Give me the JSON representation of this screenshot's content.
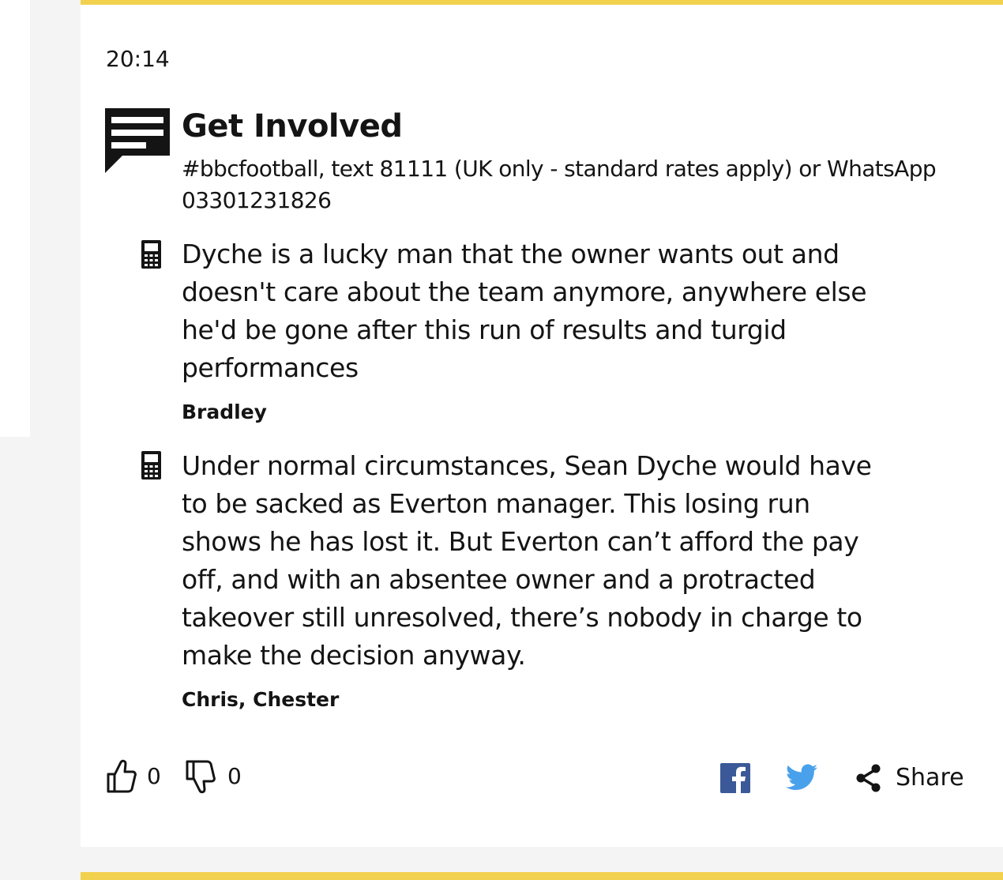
{
  "colors": {
    "accent_rule": "#f2d14f",
    "facebook": "#3b5998",
    "twitter": "#4aa1eb",
    "text": "#141414"
  },
  "post": {
    "time": "20:14",
    "get_involved": {
      "icon": "speech-bubble-icon",
      "title": "Get Involved",
      "subtitle": "#bbcfootball, text 81111 (UK only - standard rates apply) or WhatsApp 03301231826"
    },
    "messages": [
      {
        "icon": "mobile-phone-icon",
        "text": "Dyche is a lucky man that the owner wants out and doesn't care about the team anymore, anywhere else he'd be gone after this run of results and turgid performances",
        "author": "Bradley"
      },
      {
        "icon": "mobile-phone-icon",
        "text": "Under normal circumstances, Sean Dyche would have to be sacked as Everton manager. This losing run shows he has lost it. But Everton can’t afford the pay off, and with an absentee owner and a protracted takeover still unresolved, there’s nobody in charge to make the decision anyway.",
        "author": "Chris, Chester"
      }
    ],
    "footer": {
      "likes": "0",
      "dislikes": "0",
      "share_label": "Share",
      "icons": [
        "thumbs-up-icon",
        "thumbs-down-icon",
        "facebook-icon",
        "twitter-icon",
        "share-icon"
      ]
    }
  }
}
